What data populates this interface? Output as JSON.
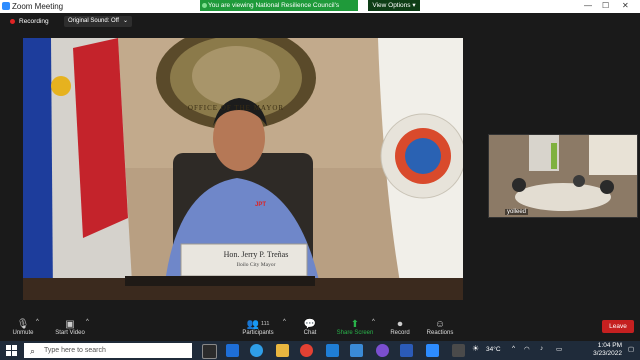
{
  "window": {
    "title": "Zoom Meeting",
    "minimize": "—",
    "maximize": "☐",
    "close": "✕"
  },
  "banner": {
    "text": "You are viewing National Resilience Council's screen",
    "view_options": "View Options"
  },
  "recording": {
    "label": "Recording"
  },
  "sound": {
    "value": "Original Sound: Off",
    "caret": "⌄"
  },
  "video": {
    "nameplate_line1": "Hon. Jerry P. Treñas",
    "nameplate_line2": "Iloilo City Mayor",
    "seal_text": "OFFICE OF THE MAYOR",
    "shirt_text": "JPT"
  },
  "self_view": {
    "name": "yolleed"
  },
  "toolbar": {
    "unmute": "Unmute",
    "start_video": "Start Video",
    "participants": "Participants",
    "participants_count": "111",
    "chat": "Chat",
    "share_screen": "Share Screen",
    "record": "Record",
    "reactions": "Reactions",
    "leave": "Leave"
  },
  "taskbar": {
    "search_placeholder": "Type here to search",
    "temperature": "34°C",
    "time": "1:04 PM",
    "date": "3/23/2022"
  },
  "colors": {
    "accent_green": "#1f9a3a",
    "leave_red": "#c52020",
    "zoom_blue": "#2d8cff"
  }
}
